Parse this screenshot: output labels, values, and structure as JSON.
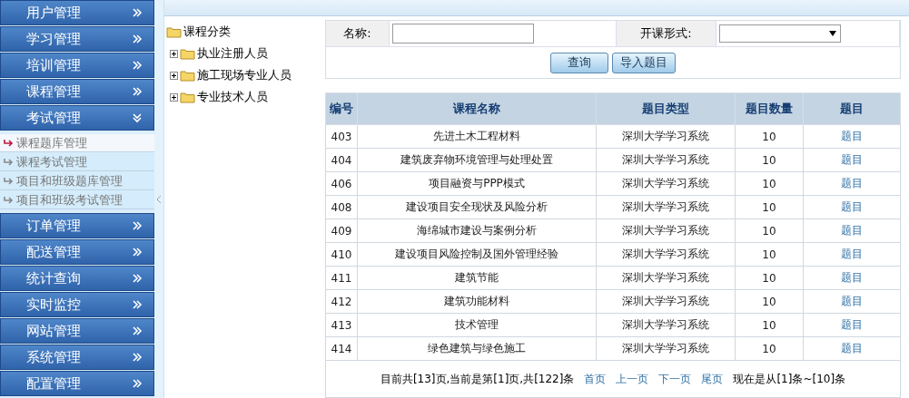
{
  "menu": [
    {
      "label": "用户管理",
      "expanded": false
    },
    {
      "label": "学习管理",
      "expanded": false
    },
    {
      "label": "培训管理",
      "expanded": false
    },
    {
      "label": "课程管理",
      "expanded": false
    },
    {
      "label": "考试管理",
      "expanded": true,
      "children": [
        {
          "label": "课程题库管理",
          "selected": true
        },
        {
          "label": "课程考试管理",
          "selected": false
        },
        {
          "label": "项目和班级题库管理",
          "selected": false
        },
        {
          "label": "项目和班级考试管理",
          "selected": false
        }
      ]
    },
    {
      "label": "订单管理",
      "expanded": false
    },
    {
      "label": "配送管理",
      "expanded": false
    },
    {
      "label": "统计查询",
      "expanded": false
    },
    {
      "label": "实时监控",
      "expanded": false
    },
    {
      "label": "网站管理",
      "expanded": false
    },
    {
      "label": "系统管理",
      "expanded": false
    },
    {
      "label": "配置管理",
      "expanded": false
    }
  ],
  "tree": {
    "label": "课程分类",
    "children": [
      {
        "label": "执业注册人员",
        "expanded": false
      },
      {
        "label": "施工现场专业人员",
        "expanded": false
      },
      {
        "label": "专业技术人员",
        "expanded": false
      }
    ]
  },
  "search": {
    "name_label": "名称:",
    "mode_label": "开课形式:",
    "query_button": "查询",
    "import_button": "导入题目"
  },
  "table": {
    "columns": [
      "编号",
      "课程名称",
      "题目类型",
      "题目数量",
      "题目"
    ],
    "rows": [
      [
        "403",
        "先进土木工程材料",
        "深圳大学学习系统",
        "10",
        "题目"
      ],
      [
        "404",
        "建筑废弃物环境管理与处理处置",
        "深圳大学学习系统",
        "10",
        "题目"
      ],
      [
        "406",
        "项目融资与PPP模式",
        "深圳大学学习系统",
        "10",
        "题目"
      ],
      [
        "408",
        "建设项目安全现状及风险分析",
        "深圳大学学习系统",
        "10",
        "题目"
      ],
      [
        "409",
        "海绵城市建设与案例分析",
        "深圳大学学习系统",
        "10",
        "题目"
      ],
      [
        "410",
        "建设项目风险控制及国外管理经验",
        "深圳大学学习系统",
        "10",
        "题目"
      ],
      [
        "411",
        "建筑节能",
        "深圳大学学习系统",
        "10",
        "题目"
      ],
      [
        "412",
        "建筑功能材料",
        "深圳大学学习系统",
        "10",
        "题目"
      ],
      [
        "413",
        "技术管理",
        "深圳大学学习系统",
        "10",
        "题目"
      ],
      [
        "414",
        "绿色建筑与绿色施工",
        "深圳大学学习系统",
        "10",
        "题目"
      ]
    ]
  },
  "pager": {
    "summary": "目前共[13]页,当前是第[1]页,共[122]条",
    "links": [
      "首页",
      "上一页",
      "下一页",
      "尾页"
    ],
    "range": "现在是从[1]条~[10]条"
  }
}
